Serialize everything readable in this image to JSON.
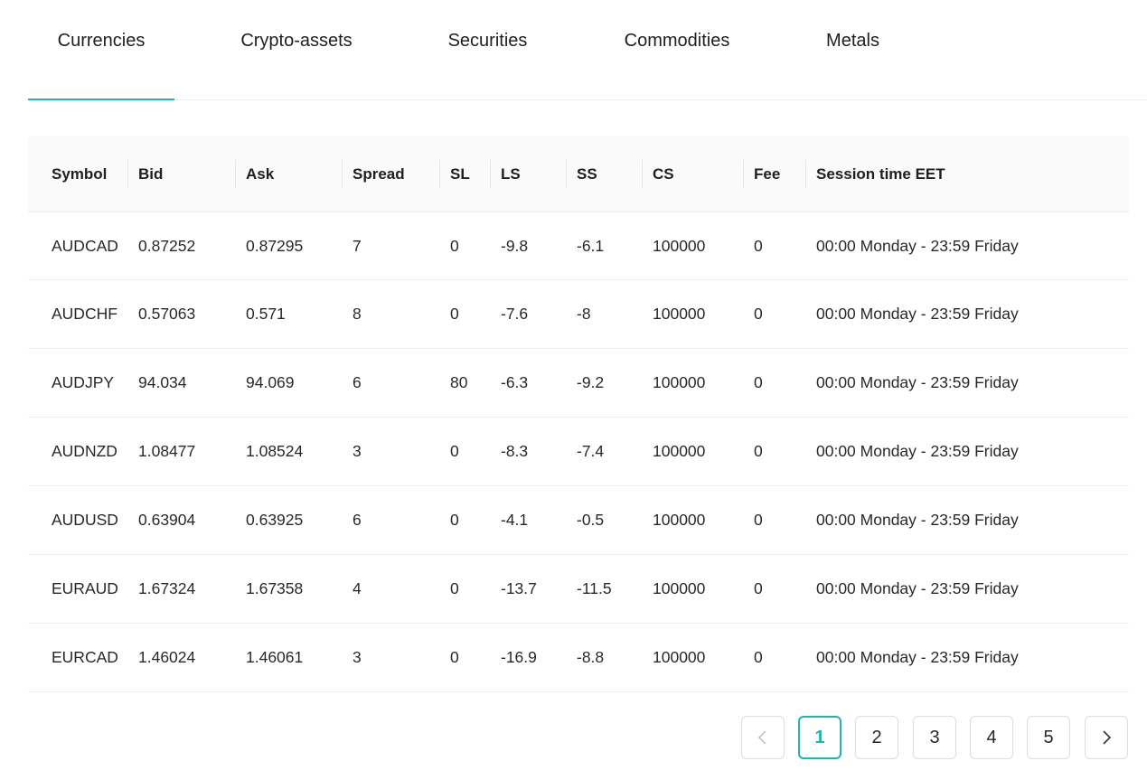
{
  "tabs": [
    {
      "label": "Currencies",
      "active": true
    },
    {
      "label": "Crypto-assets",
      "active": false
    },
    {
      "label": "Securities",
      "active": false
    },
    {
      "label": "Commodities",
      "active": false
    },
    {
      "label": "Metals",
      "active": false
    }
  ],
  "table": {
    "columns": [
      "Symbol",
      "Bid",
      "Ask",
      "Spread",
      "SL",
      "LS",
      "SS",
      "CS",
      "Fee",
      "Session time EET"
    ],
    "rows": [
      [
        "AUDCAD",
        "0.87252",
        "0.87295",
        "7",
        "0",
        "-9.8",
        "-6.1",
        "100000",
        "0",
        "00:00 Monday - 23:59 Friday"
      ],
      [
        "AUDCHF",
        "0.57063",
        "0.571",
        "8",
        "0",
        "-7.6",
        "-8",
        "100000",
        "0",
        "00:00 Monday - 23:59 Friday"
      ],
      [
        "AUDJPY",
        "94.034",
        "94.069",
        "6",
        "80",
        "-6.3",
        "-9.2",
        "100000",
        "0",
        "00:00 Monday - 23:59 Friday"
      ],
      [
        "AUDNZD",
        "1.08477",
        "1.08524",
        "3",
        "0",
        "-8.3",
        "-7.4",
        "100000",
        "0",
        "00:00 Monday - 23:59 Friday"
      ],
      [
        "AUDUSD",
        "0.63904",
        "0.63925",
        "6",
        "0",
        "-4.1",
        "-0.5",
        "100000",
        "0",
        "00:00 Monday - 23:59 Friday"
      ],
      [
        "EURAUD",
        "1.67324",
        "1.67358",
        "4",
        "0",
        "-13.7",
        "-11.5",
        "100000",
        "0",
        "00:00 Monday - 23:59 Friday"
      ],
      [
        "EURCAD",
        "1.46024",
        "1.46061",
        "3",
        "0",
        "-16.9",
        "-8.8",
        "100000",
        "0",
        "00:00 Monday - 23:59 Friday"
      ]
    ]
  },
  "pagination": {
    "prev_icon": "chevron-left-icon",
    "next_icon": "chevron-right-icon",
    "pages": [
      "1",
      "2",
      "3",
      "4",
      "5"
    ],
    "current": "1"
  },
  "colors": {
    "accent": "#1bb5b5",
    "header_bg": "#fafafa",
    "divider": "#eeeeee"
  }
}
